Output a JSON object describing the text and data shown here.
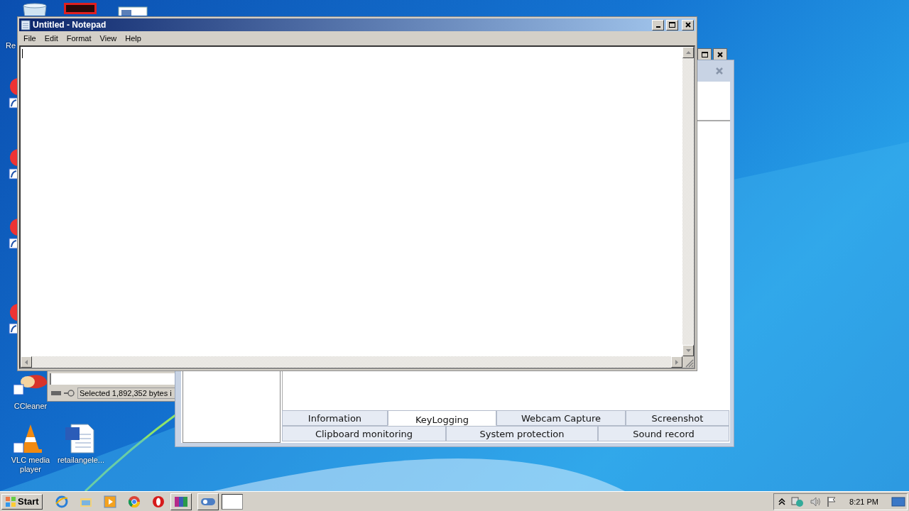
{
  "desktop_icons": [
    {
      "kind": "bin",
      "label": "Re"
    },
    {
      "kind": "ccleaner",
      "label": "CCleaner"
    },
    {
      "kind": "vlc",
      "label": "VLC media player"
    },
    {
      "kind": "word",
      "label": "retailangele..."
    }
  ],
  "notepad": {
    "title": "Untitled - Notepad",
    "menu": [
      "File",
      "Edit",
      "Format",
      "View",
      "Help"
    ]
  },
  "explorer": {
    "status": "Selected 1,892,352 bytes i"
  },
  "monitor_window": {
    "tab_rows": [
      [
        {
          "label": "Information",
          "selected": false
        },
        {
          "label": "KeyLogging",
          "selected": true
        },
        {
          "label": "Webcam Capture",
          "selected": false
        },
        {
          "label": "Screenshot",
          "selected": false
        }
      ],
      [
        {
          "label": "Clipboard monitoring",
          "selected": false
        },
        {
          "label": "System protection",
          "selected": false
        },
        {
          "label": "Sound record",
          "selected": false
        }
      ]
    ]
  },
  "taskbar": {
    "start": "Start",
    "clock": "8:21 PM"
  }
}
